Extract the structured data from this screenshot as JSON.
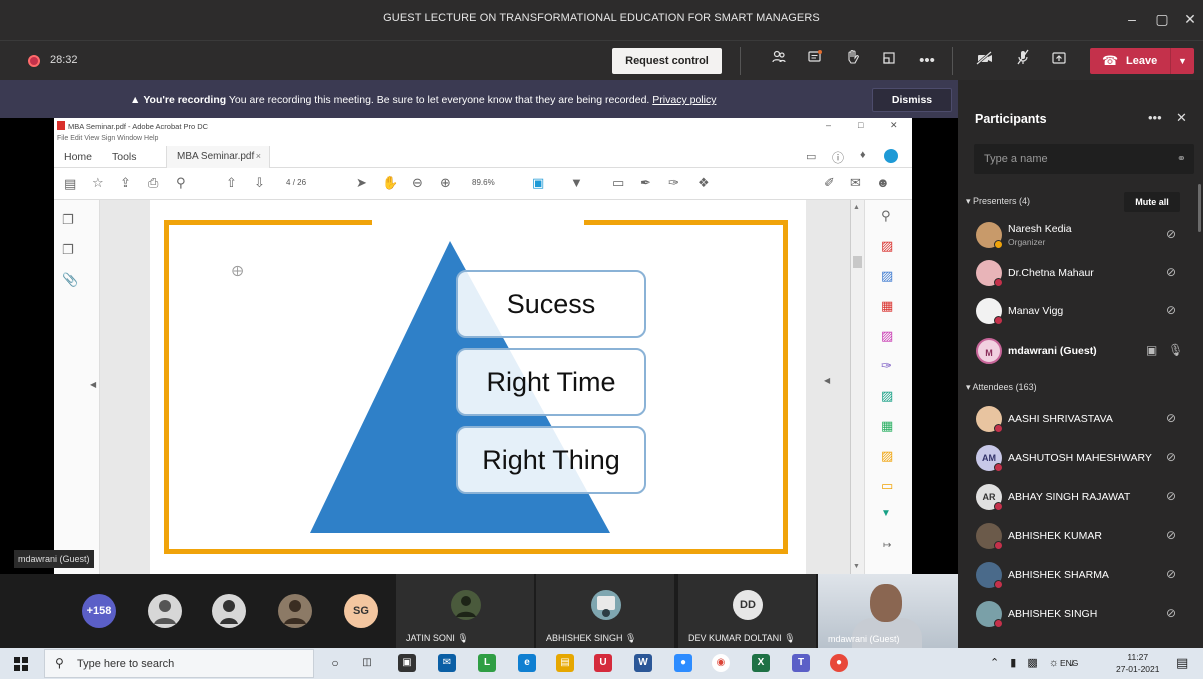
{
  "window": {
    "title": "GUEST LECTURE ON TRANSFORMATIONAL EDUCATION FOR SMART MANAGERS",
    "minimize": "–",
    "maximize": "▢",
    "close": "✕"
  },
  "toolbar": {
    "timer": "28:32",
    "request_control_label": "Request control",
    "leave_label": "Leave"
  },
  "banner": {
    "bold": "You're recording",
    "text": "You are recording this meeting. Be sure to let everyone know that they are being recorded.",
    "link": "Privacy policy",
    "dismiss_label": "Dismiss"
  },
  "acrobat": {
    "title": "MBA Seminar.pdf - Adobe Acrobat Pro DC",
    "menu": "File   Edit   View   Sign   Window   Help",
    "tab_home": "Home",
    "tab_tools": "Tools",
    "doc_tab": "MBA Seminar.pdf",
    "doc_tab_close": "×",
    "page_current": "4",
    "page_total": "/ 26",
    "zoom": "89.6%"
  },
  "slide": {
    "items": [
      "Sucess",
      "Right Time",
      "Right Thing"
    ],
    "pyramid_color": "#2f80c8",
    "frame_color": "#f0a30a"
  },
  "presenter_label": "mdawrani (Guest)",
  "gallery": {
    "overflow_count": "+158",
    "sg_initials": "SG",
    "tiles": [
      {
        "name": "JATIN SONI"
      },
      {
        "name": "ABHISHEK SINGH"
      },
      {
        "name": "DEV KUMAR DOLTANI",
        "initials": "DD"
      }
    ],
    "video_name": "mdawrani (Guest)"
  },
  "panel": {
    "title": "Participants",
    "search_placeholder": "Type a name",
    "presenters_header": "Presenters (4)",
    "mute_all_label": "Mute all",
    "attendees_header": "Attendees (163)",
    "presenters": [
      {
        "name": "Naresh Kedia",
        "role": "Organizer"
      },
      {
        "name": "Dr.Chetna Mahaur"
      },
      {
        "name": "Manav Vigg"
      },
      {
        "name": "mdawrani (Guest)",
        "initials": "M"
      }
    ],
    "attendees": [
      {
        "name": "AASHI SHRIVASTAVA"
      },
      {
        "name": "AASHUTOSH MAHESHWARY",
        "initials": "AM"
      },
      {
        "name": "ABHAY SINGH RAJAWAT",
        "initials": "AR"
      },
      {
        "name": "ABHISHEK KUMAR"
      },
      {
        "name": "ABHISHEK SHARMA"
      },
      {
        "name": "ABHISHEK SINGH"
      }
    ]
  },
  "taskbar": {
    "search_placeholder": "Type here to search",
    "lang": "ENG",
    "time": "11:27",
    "date": "27-01-2021"
  },
  "colors": {
    "leave": "#c4314b",
    "banner": "#3b3a52",
    "accent": "#6264a7"
  }
}
